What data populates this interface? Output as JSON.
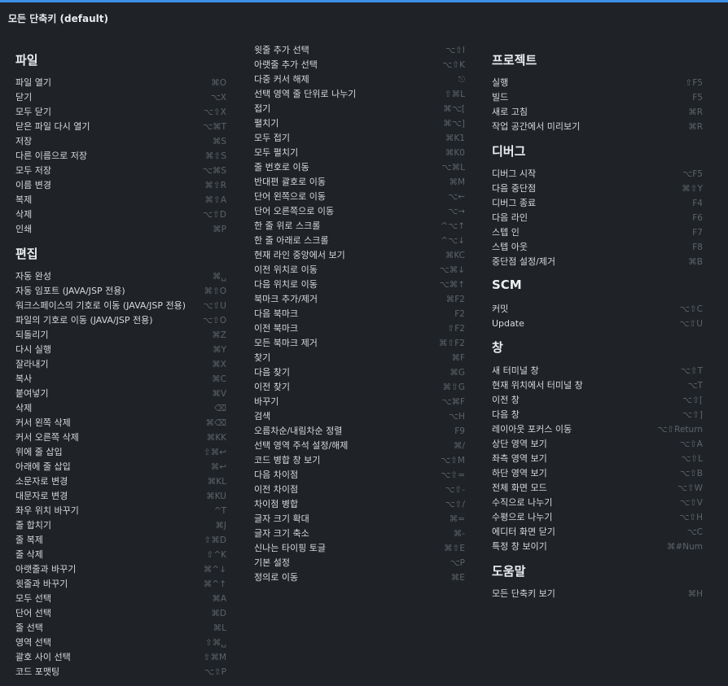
{
  "title": "모든 단축키 (default)",
  "columns": [
    {
      "sections": [
        {
          "title": "파일",
          "items": [
            {
              "label": "파일 열기",
              "key": "⌘O"
            },
            {
              "label": "닫기",
              "key": "⌥X"
            },
            {
              "label": "모두 닫기",
              "key": "⌥⇧X"
            },
            {
              "label": "닫은 파일 다시 열기",
              "key": "⌥⌘T"
            },
            {
              "label": "저장",
              "key": "⌘S"
            },
            {
              "label": "다른 이름으로 저장",
              "key": "⌘⇧S"
            },
            {
              "label": "모두 저장",
              "key": "⌥⌘S"
            },
            {
              "label": "이름 변경",
              "key": "⌘⇧R"
            },
            {
              "label": "복제",
              "key": "⌘⇧A"
            },
            {
              "label": "삭제",
              "key": "⌥⇧D"
            },
            {
              "label": "인쇄",
              "key": "⌘P"
            }
          ]
        },
        {
          "title": "편집",
          "items": [
            {
              "label": "자동 완성",
              "key": "⌘␣"
            },
            {
              "label": "자동 임포트 (JAVA/JSP 전용)",
              "key": "⌘⇧O"
            },
            {
              "label": "워크스페이스의 기호로 이동 (JAVA/JSP 전용)",
              "key": "⌥⇧U"
            },
            {
              "label": "파일의 기호로 이동 (JAVA/JSP 전용)",
              "key": "⌥⇧O"
            },
            {
              "label": "되돌리기",
              "key": "⌘Z"
            },
            {
              "label": "다시 실행",
              "key": "⌘Y"
            },
            {
              "label": "잘라내기",
              "key": "⌘X"
            },
            {
              "label": "복사",
              "key": "⌘C"
            },
            {
              "label": "붙여넣기",
              "key": "⌘V"
            },
            {
              "label": "삭제",
              "key": "⌫"
            },
            {
              "label": "커서 왼쪽 삭제",
              "key": "⌘⌫"
            },
            {
              "label": "커서 오른쪽 삭제",
              "key": "⌘KK"
            },
            {
              "label": "위에 줄 삽입",
              "key": "⇧⌘↩"
            },
            {
              "label": "아래에 줄 삽입",
              "key": "⌘↩"
            },
            {
              "label": "소문자로 변경",
              "key": "⌘KL"
            },
            {
              "label": "대문자로 변경",
              "key": "⌘KU"
            },
            {
              "label": "좌우 위치 바꾸기",
              "key": "^T"
            },
            {
              "label": "줄 합치기",
              "key": "⌘J"
            },
            {
              "label": "줄 복제",
              "key": "⇧⌘D"
            },
            {
              "label": "줄 삭제",
              "key": "⇧^K"
            },
            {
              "label": "아랫줄과 바꾸기",
              "key": "⌘^↓"
            },
            {
              "label": "윗줄과 바꾸기",
              "key": "⌘^↑"
            },
            {
              "label": "모두 선택",
              "key": "⌘A"
            },
            {
              "label": "단어 선택",
              "key": "⌘D"
            },
            {
              "label": "줄 선택",
              "key": "⌘L"
            },
            {
              "label": "영역 선택",
              "key": "⇧⌘␣"
            },
            {
              "label": "괄호 사이 선택",
              "key": "⇧⌘M"
            },
            {
              "label": "코드 포맷팅",
              "key": "⌥⇧P"
            }
          ]
        }
      ]
    },
    {
      "sections": [
        {
          "title": "",
          "items": [
            {
              "label": "윗줄 추가 선택",
              "key": "⌥⇧I"
            },
            {
              "label": "아랫줄 추가 선택",
              "key": "⌥⇧K"
            },
            {
              "label": "다중 커서 해제",
              "key": "⎋"
            },
            {
              "label": "선택 영역 줄 단위로 나누기",
              "key": "⇧⌘L"
            },
            {
              "label": "접기",
              "key": "⌘⌥["
            },
            {
              "label": "펼치기",
              "key": "⌘⌥]"
            },
            {
              "label": "모두 접기",
              "key": "⌘K1"
            },
            {
              "label": "모두 펼치기",
              "key": "⌘K0"
            },
            {
              "label": "줄 번호로 이동",
              "key": "⌥⌘L"
            },
            {
              "label": "반대편 괄호로 이동",
              "key": "⌘M"
            },
            {
              "label": "단어 왼쪽으로 이동",
              "key": "⌥←"
            },
            {
              "label": "단어 오른쪽으로 이동",
              "key": "⌥→"
            },
            {
              "label": "한 줄 위로 스크롤",
              "key": "^⌥↑"
            },
            {
              "label": "한 줄 아래로 스크롤",
              "key": "^⌥↓"
            },
            {
              "label": "현재 라인 중앙에서 보기",
              "key": "⌘KC"
            },
            {
              "label": "이전 위치로 이동",
              "key": "⌥⌘↓"
            },
            {
              "label": "다음 위치로 이동",
              "key": "⌥⌘↑"
            },
            {
              "label": "북마크 추가/제거",
              "key": "⌘F2"
            },
            {
              "label": "다음 북마크",
              "key": "F2"
            },
            {
              "label": "이전 북마크",
              "key": "⇧F2"
            },
            {
              "label": "모든 북마크 제거",
              "key": "⌘⇧F2"
            },
            {
              "label": "찾기",
              "key": "⌘F"
            },
            {
              "label": "다음 찾기",
              "key": "⌘G"
            },
            {
              "label": "이전 찾기",
              "key": "⌘⇧G"
            },
            {
              "label": "바꾸기",
              "key": "⌥⌘F"
            },
            {
              "label": "검색",
              "key": "⌥H"
            },
            {
              "label": "오름차순/내림차순 정렬",
              "key": "F9"
            },
            {
              "label": "선택 영역 주석 설정/해제",
              "key": "⌘/"
            },
            {
              "label": "코드 병합 창 보기",
              "key": "⌥⇧M"
            },
            {
              "label": "다음 차이점",
              "key": "⌥⇧="
            },
            {
              "label": "이전 차이점",
              "key": "⌥⇧-"
            },
            {
              "label": "차이점 병합",
              "key": "⌥⇧/"
            },
            {
              "label": "글자 크기 확대",
              "key": "⌘="
            },
            {
              "label": "글자 크기 축소",
              "key": "⌘-"
            },
            {
              "label": "신나는 타이핑 토글",
              "key": "⌘⇧E"
            },
            {
              "label": "기본 설정",
              "key": "⌥P"
            },
            {
              "label": "정의로 이동",
              "key": "⌘E"
            }
          ]
        }
      ]
    },
    {
      "sections": [
        {
          "title": "프로젝트",
          "items": [
            {
              "label": "실행",
              "key": "⇧F5"
            },
            {
              "label": "빌드",
              "key": "F5"
            },
            {
              "label": "새로 고침",
              "key": "⌘R"
            },
            {
              "label": "작업 공간에서 미리보기",
              "key": "⌘R"
            }
          ]
        },
        {
          "title": "디버그",
          "items": [
            {
              "label": "디버그 시작",
              "key": "⌥F5"
            },
            {
              "label": "다음 중단점",
              "key": "⌘⇧Y"
            },
            {
              "label": "디버그 종료",
              "key": "F4"
            },
            {
              "label": "다음 라인",
              "key": "F6"
            },
            {
              "label": "스텝 인",
              "key": "F7"
            },
            {
              "label": "스텝 아웃",
              "key": "F8"
            },
            {
              "label": "중단점 설정/제거",
              "key": "⌘B"
            }
          ]
        },
        {
          "title": "SCM",
          "items": [
            {
              "label": "커밋",
              "key": "⌥⇧C"
            },
            {
              "label": "Update",
              "key": "⌥⇧U"
            }
          ]
        },
        {
          "title": "창",
          "items": [
            {
              "label": "새 터미널 창",
              "key": "⌥⇧T"
            },
            {
              "label": "현재 위치에서 터미널 창",
              "key": "⌥T"
            },
            {
              "label": "이전 창",
              "key": "⌥⇧["
            },
            {
              "label": "다음 창",
              "key": "⌥⇧]"
            },
            {
              "label": "레이아웃 포커스 이동",
              "key": "⌥⇧Return"
            },
            {
              "label": "상단 영역 보기",
              "key": "⌥⇧A"
            },
            {
              "label": "좌측 영역 보기",
              "key": "⌥⇧L"
            },
            {
              "label": "하단 영역 보기",
              "key": "⌥⇧B"
            },
            {
              "label": "전체 화면 모드",
              "key": "⌥⇧W"
            },
            {
              "label": "수직으로 나누기",
              "key": "⌥⇧V"
            },
            {
              "label": "수평으로 나누기",
              "key": "⌥⇧H"
            },
            {
              "label": "에디터 화면 닫기",
              "key": "⌥C"
            },
            {
              "label": "특정 창 보이기",
              "key": "⌘#Num"
            }
          ]
        },
        {
          "title": "도움말",
          "items": [
            {
              "label": "모든 단축키 보기",
              "key": "⌘H"
            }
          ]
        }
      ]
    }
  ]
}
